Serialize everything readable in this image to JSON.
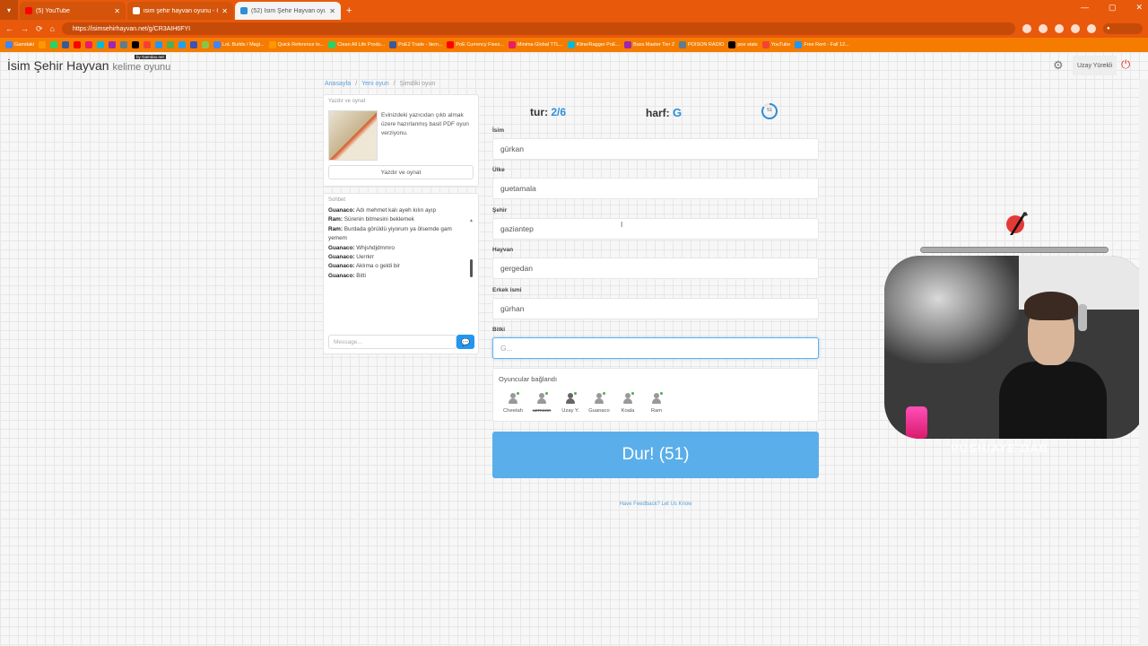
{
  "browser": {
    "tabs": [
      {
        "title": "(5) YouTube",
        "color": "#ff0000"
      },
      {
        "title": "isim şehir hayvan oyunu - Google",
        "color": "#4285f4"
      },
      {
        "title": "(52) İsim Şehir Hayvan oyunu...",
        "color": "#2f8fd6"
      }
    ],
    "url": "https://isimsehirhayvan.net/g/CR3AIH6FYI",
    "bookmarks": [
      "Gamdaki",
      "",
      "",
      "",
      "",
      "",
      "",
      "",
      "",
      "",
      "",
      "",
      "",
      "",
      "",
      "",
      "LoL Builds / Magi...",
      "Quick Reference to...",
      "Clean All Life Produ...",
      "PoE2 Trade - Item...",
      "PoE Currency Fixes...",
      "Minima Global TTL...",
      "Kline/Ragger PoE...",
      "Bass Master Tier 2",
      "POISON RADIO",
      "poe stats",
      "YouTube",
      "Free Rent - Fall 12..."
    ]
  },
  "site": {
    "brand": "İsim Şehir Hayvan",
    "brand_sub": "kelime oyunu",
    "brand_tag": "by Gamdao.net",
    "username": "Uzay Yürekli"
  },
  "breadcrumb": [
    "Anasayfa",
    "Yeni oyun",
    "Şimdiki oyun"
  ],
  "print_card": {
    "header": "Yazdır ve oynat",
    "text": "Evinizdeki yazıcıdan çıktı almak üzere hazırlanmış basit PDF oyun verziyonu.",
    "button": "Yazdır ve oynat"
  },
  "chat": {
    "header": "Sohbet",
    "messages": [
      {
        "user": "Guanaco:",
        "text": "Adı mehmet kalı ayeh kılın ayıp"
      },
      {
        "user": "Ram:",
        "text": "Sürenin bitmesini beklemek"
      },
      {
        "user": "Ram:",
        "text": "Burdada görüldü yiyorum ya ölsemde gam yemem"
      },
      {
        "user": "Guanaco:",
        "text": "Whjshdjdmmro"
      },
      {
        "user": "Guanaco:",
        "text": "Uerrkrr"
      },
      {
        "user": "Guanaco:",
        "text": "Aklıma o geldi bir"
      },
      {
        "user": "Guanaco:",
        "text": "Bitti"
      }
    ],
    "placeholder": "Message..."
  },
  "game": {
    "round_label": "tur:",
    "round_value": "2/6",
    "letter_label": "harf:",
    "letter_value": "G",
    "timer": "51",
    "timer_fraction": 0.85,
    "fields": [
      {
        "label": "İsim",
        "value": "gürkan"
      },
      {
        "label": "Ülke",
        "value": "guetamala"
      },
      {
        "label": "Şehir",
        "value": "gaziantep"
      },
      {
        "label": "Hayvan",
        "value": "gergedan"
      },
      {
        "label": "Erkek ismi",
        "value": "gürhan"
      },
      {
        "label": "Bitki",
        "value": "",
        "placeholder": "G..."
      }
    ],
    "players_header": "Oyuncular bağlandı",
    "players": [
      {
        "name": "Cheetah",
        "struck": false,
        "dark": false
      },
      {
        "name": "uzmoon",
        "struck": true,
        "dark": false
      },
      {
        "name": "Uzay Y.",
        "struck": false,
        "dark": true
      },
      {
        "name": "Guanaco",
        "struck": false,
        "dark": false
      },
      {
        "name": "Koala",
        "struck": false,
        "dark": false
      },
      {
        "name": "Ram",
        "struck": false,
        "dark": false
      }
    ],
    "stop_button": "Dur! (51)",
    "feedback": "Have Feedback? Let Us Know"
  },
  "overlay": {
    "progress_fraction": 1.0,
    "caption": "PUSH/AYE DAB"
  },
  "colors": {
    "browser_chrome": "#e8590c",
    "accent_blue": "#2f8fd6",
    "stop_button": "#5aaeea",
    "chat_send": "#2196f3"
  }
}
